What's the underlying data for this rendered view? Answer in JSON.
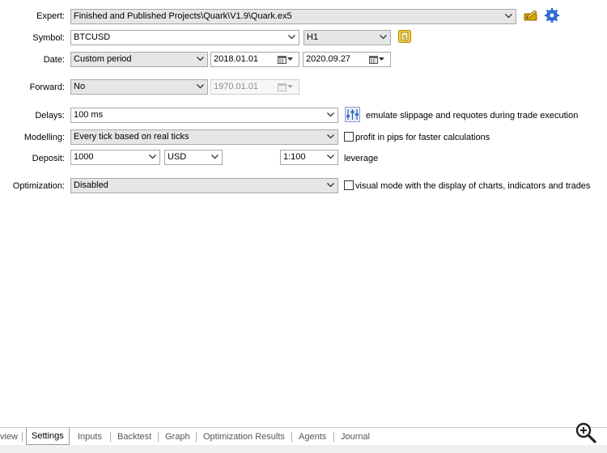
{
  "form": {
    "expert": {
      "label": "Expert:",
      "value": "Finished and Published Projects\\Quark\\V1.9\\Quark.ex5"
    },
    "symbol": {
      "label": "Symbol:",
      "value": "BTCUSD",
      "timeframe": "H1"
    },
    "date": {
      "label": "Date:",
      "period": "Custom period",
      "from": "2018.01.01",
      "to": "2020.09.27"
    },
    "forward": {
      "label": "Forward:",
      "value": "No",
      "date": "1970.01.01"
    },
    "delays": {
      "label": "Delays:",
      "value": "100 ms",
      "note": "emulate slippage and requotes during trade execution"
    },
    "modelling": {
      "label": "Modelling:",
      "value": "Every tick based on real ticks",
      "checkbox_label": "profit in pips for faster calculations",
      "checked": false
    },
    "deposit": {
      "label": "Deposit:",
      "value": "1000",
      "currency": "USD",
      "leverage": "1:100",
      "leverage_label": "leverage"
    },
    "optimization": {
      "label": "Optimization:",
      "value": "Disabled",
      "checkbox_label": "visual mode with the display of charts, indicators and trades",
      "checked": false
    }
  },
  "tabs": [
    {
      "label": "view",
      "active": false
    },
    {
      "label": "Settings",
      "active": true
    },
    {
      "label": "Inputs",
      "active": false
    },
    {
      "label": "Backtest",
      "active": false
    },
    {
      "label": "Graph",
      "active": false
    },
    {
      "label": "Optimization Results",
      "active": false
    },
    {
      "label": "Agents",
      "active": false
    },
    {
      "label": "Journal",
      "active": false
    }
  ],
  "icons": {
    "edit_expert": "edit-pencil-icon",
    "expert_settings": "gear-icon",
    "symbol_properties": "symbol-properties-icon",
    "delays_settings": "sliders-icon",
    "zoom": "zoom-in-icon"
  },
  "colors": {
    "accent": "#2f6fd6",
    "toolbar_yellow": "#e6b800"
  }
}
